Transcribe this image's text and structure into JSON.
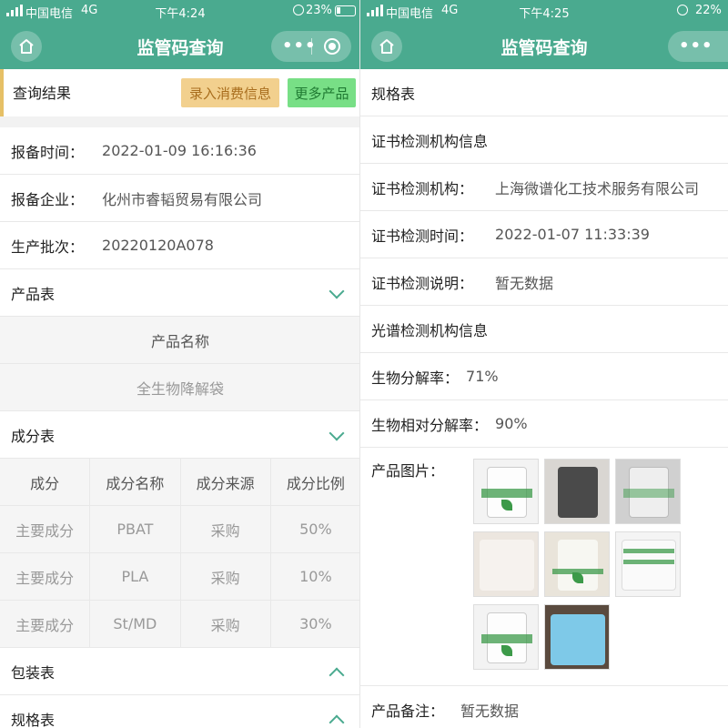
{
  "left": {
    "status": {
      "carrier": "中国电信",
      "network": "4G",
      "time": "下午4:24",
      "battery": "23%"
    },
    "nav": {
      "title": "监管码查询"
    },
    "query": {
      "label": "查询结果",
      "record_button": "录入消费信息",
      "more_button": "更多产品"
    },
    "info": [
      {
        "label": "报备时间：",
        "value": "2022-01-09 16:16:36"
      },
      {
        "label": "报备企业：",
        "value": "化州市睿韬贸易有限公司"
      },
      {
        "label": "生产批次：",
        "value": "20220120A078"
      }
    ],
    "product_section": {
      "title": "产品表",
      "header": "产品名称",
      "value": "全生物降解袋"
    },
    "composition_section": {
      "title": "成分表",
      "columns": [
        "成分",
        "成分名称",
        "成分来源",
        "成分比例"
      ],
      "rows": [
        [
          "主要成分",
          "PBAT",
          "采购",
          "50%"
        ],
        [
          "主要成分",
          "PLA",
          "采购",
          "10%"
        ],
        [
          "主要成分",
          "St/MD",
          "采购",
          "30%"
        ]
      ]
    },
    "packaging_section": {
      "title": "包装表"
    },
    "spec_section": {
      "title": "规格表"
    }
  },
  "right": {
    "status": {
      "carrier": "中国电信",
      "network": "4G",
      "time": "下午4:25",
      "battery": "22%"
    },
    "nav": {
      "title": "监管码查询"
    },
    "spec_title": "规格表",
    "cert_section_title": "证书检测机构信息",
    "cert_rows": [
      {
        "label": "证书检测机构：",
        "value": "上海微谱化工技术服务有限公司"
      },
      {
        "label": "证书检测时间：",
        "value": "2022-01-07 11:33:39"
      },
      {
        "label": "证书检测说明：",
        "value": "暂无数据"
      }
    ],
    "spectrum_section_title": "光谱检测机构信息",
    "bio_rows": [
      {
        "label": "生物分解率：",
        "value": "71%"
      },
      {
        "label": "生物相对分解率：",
        "value": "90%"
      }
    ],
    "photos_label": "产品图片：",
    "remark": {
      "label": "产品备注：",
      "value": "暂无数据"
    }
  },
  "colors": {
    "accent": "#4aaa8f",
    "record_btn_bg": "#f2d08e",
    "more_btn_bg": "#78df86"
  }
}
